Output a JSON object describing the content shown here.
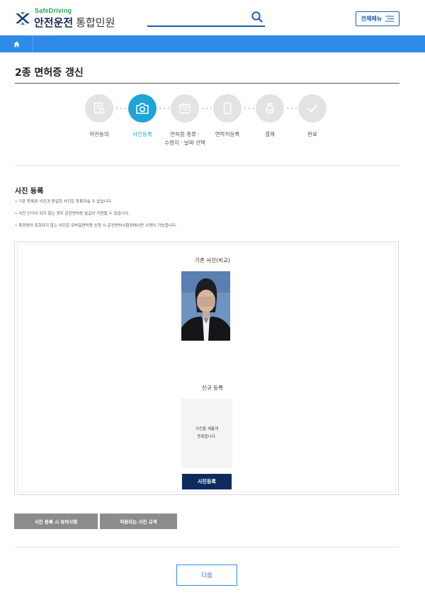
{
  "header": {
    "logo_en": "SafeDriving",
    "logo_ko": "안전운전",
    "logo_sub": "통합민원",
    "search_placeholder": "",
    "menu_label": "전체메뉴"
  },
  "page": {
    "title": "2종 면허증 갱신"
  },
  "steps": [
    {
      "label": "약관동의",
      "icon": "document-check-icon",
      "active": false
    },
    {
      "label": "사진등록",
      "icon": "camera-icon",
      "active": true
    },
    {
      "label": "면허증 종류 ·\n수령지 · 날짜 선택",
      "icon": "calendar-icon",
      "active": false
    },
    {
      "label": "연락처등록",
      "icon": "phone-icon",
      "active": false
    },
    {
      "label": "결제",
      "icon": "money-bag-icon",
      "active": false
    },
    {
      "label": "완료",
      "icon": "check-icon",
      "active": false
    }
  ],
  "section": {
    "title": "사진 등록",
    "notes": [
      "• 기존 등록된 사진과 동일한 사진은 등록하실 수 없습니다.",
      "• 사진 인식이 되지 않는 경우 운전면허증 발급이 지연될 수 있습니다.",
      "• 특정량이 조회되지 않는 사진은 모바일면허증 신청 시 운전면허시험장에서만 수령이 가능합니다."
    ]
  },
  "photo": {
    "existing_label": "기존 사진(비교)",
    "new_label": "신규 등록",
    "new_placeholder": "사진을 새롭게\n등록합니다.",
    "register_button": "사진등록"
  },
  "guides": {
    "notice_button": "사진 등록 시 유의사항",
    "rules_button": "허용되는 사진 규격"
  },
  "footer": {
    "next_button": "다음"
  },
  "colors": {
    "nav_blue": "#2f8ae8",
    "step_active": "#1ea4d9",
    "primary_dark": "#0e2b5e",
    "guide_gray": "#8c8c8c"
  }
}
